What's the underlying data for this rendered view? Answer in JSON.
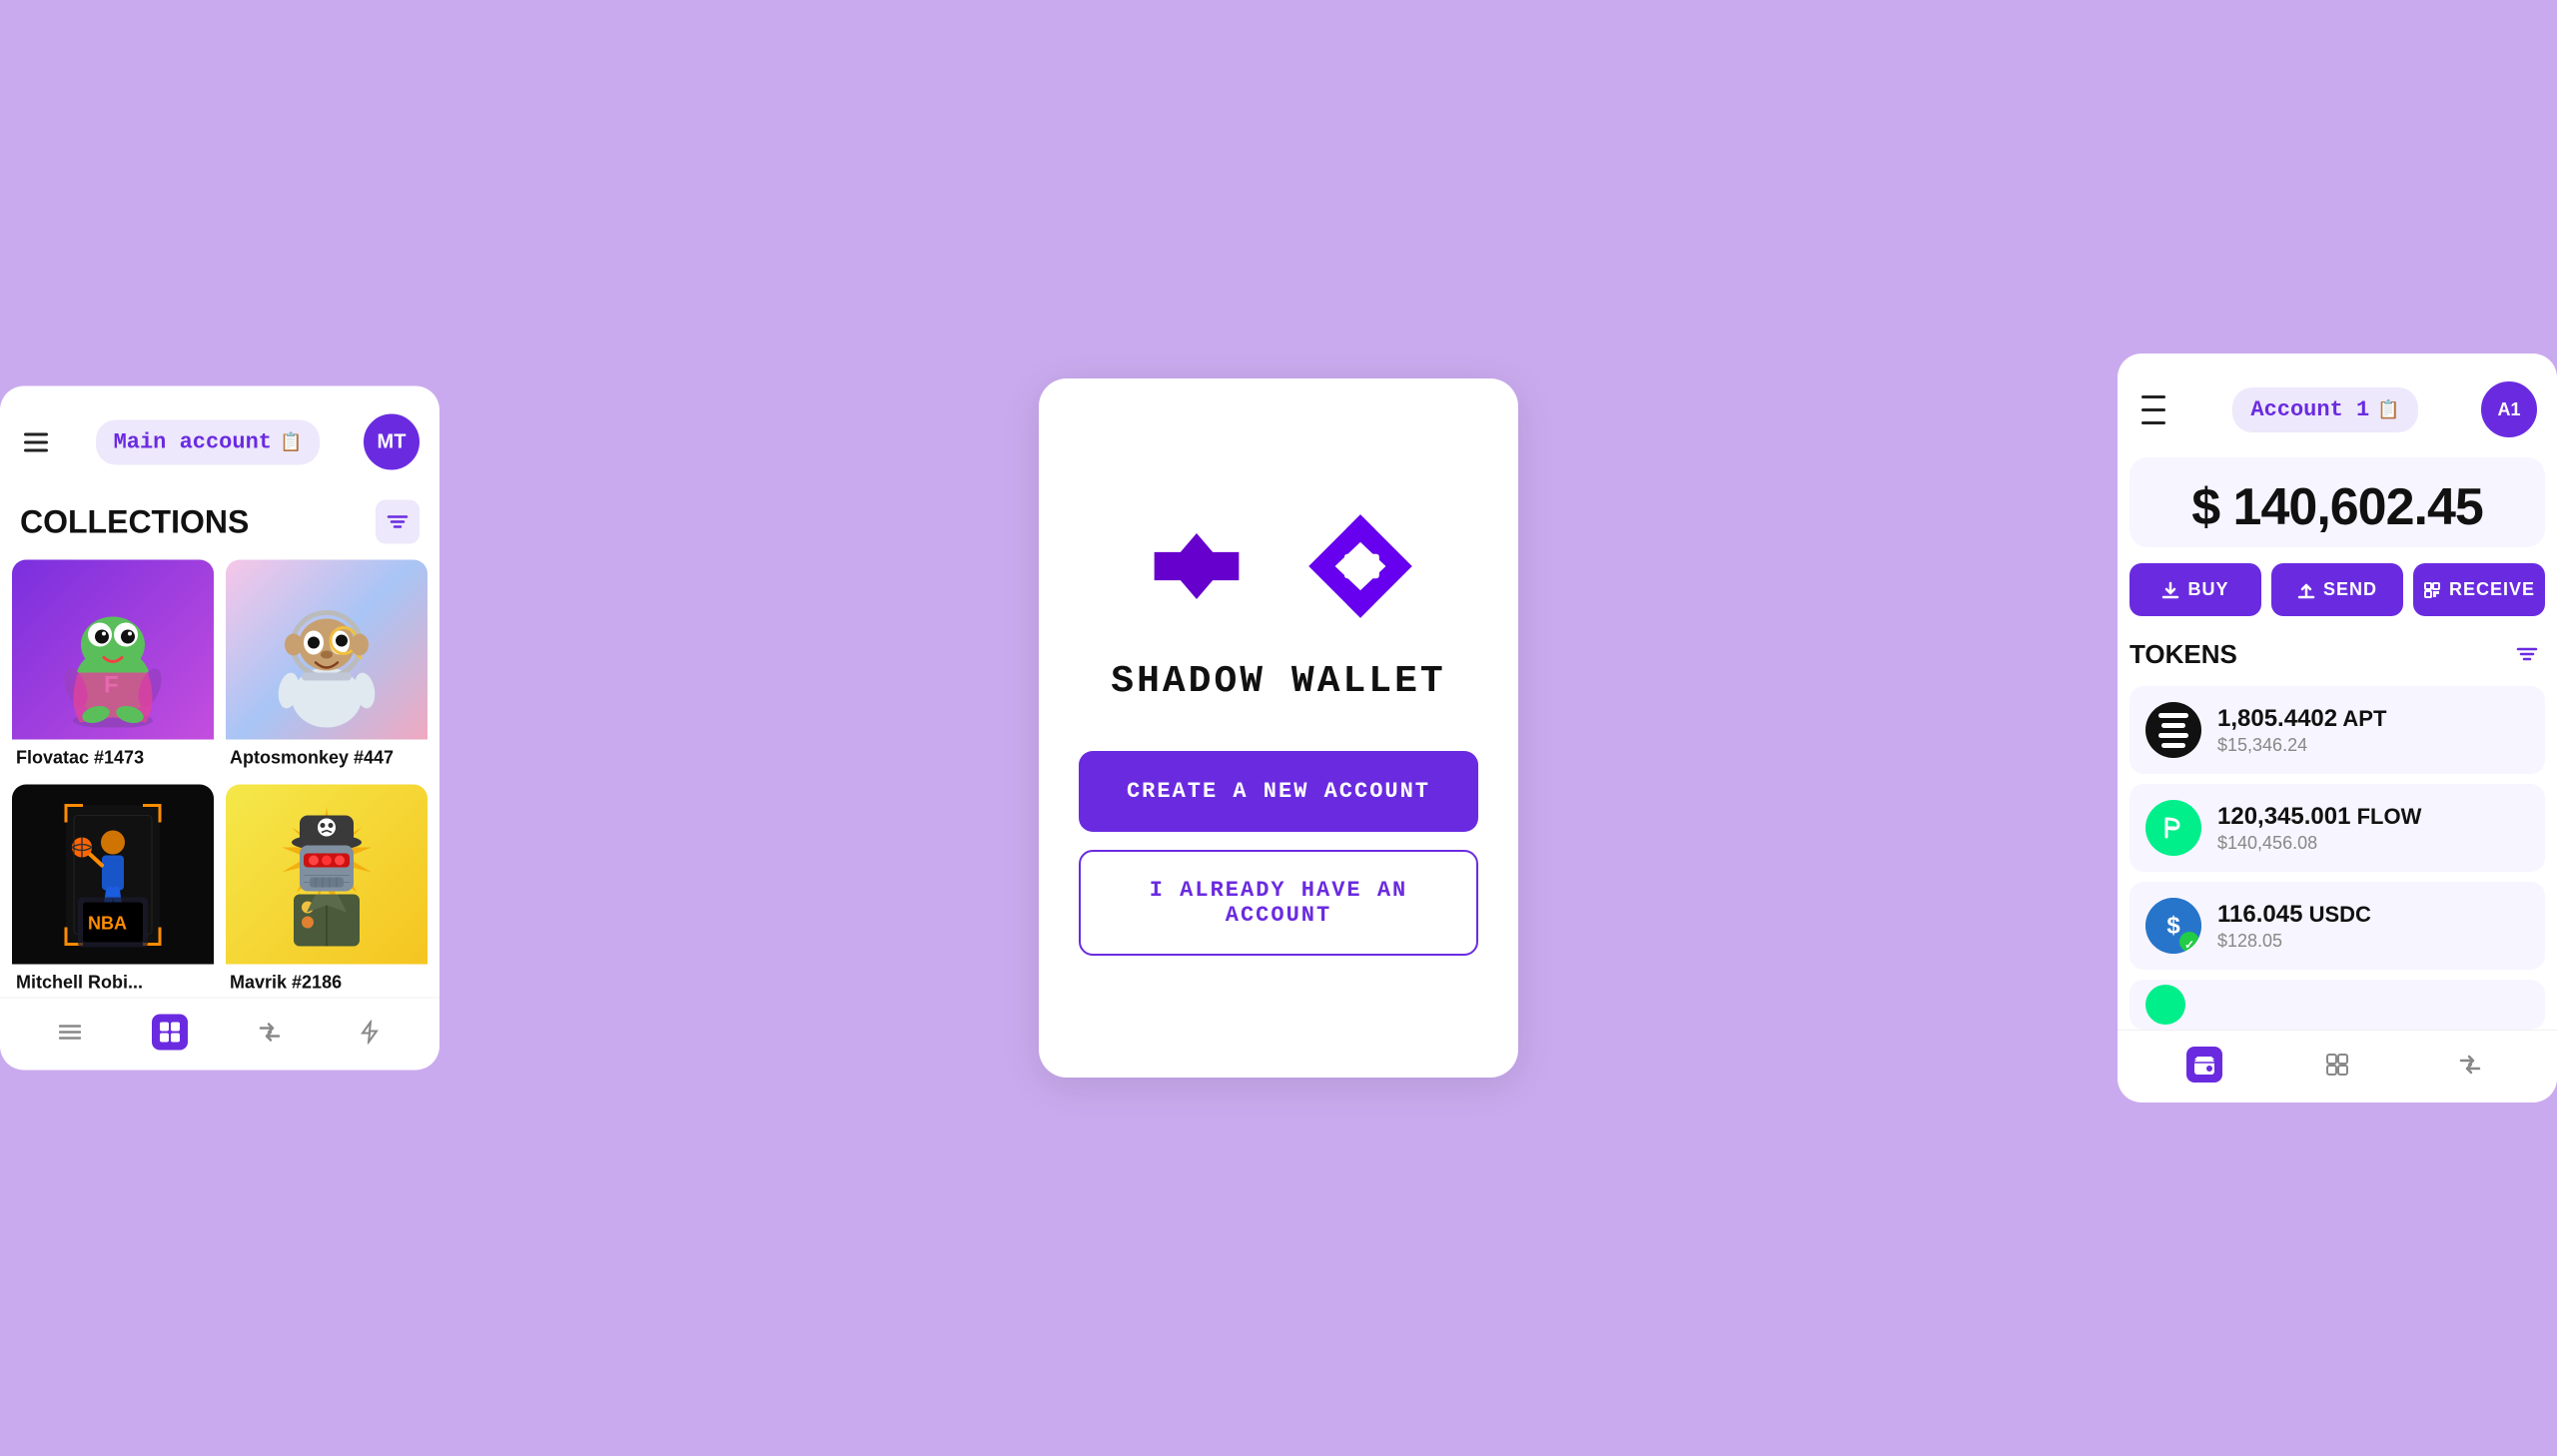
{
  "background": "#c9aaee",
  "left_panel": {
    "account_label": "Main account",
    "avatar_initials": "MT",
    "collections_title": "COLLECTIONS",
    "nfts": [
      {
        "name": "Flovatac #1473",
        "bg": "purple-bg"
      },
      {
        "name": "Aptosmonkey #447",
        "bg": "gradient-bg"
      },
      {
        "name": "Mitchell Robi...",
        "bg": "dark-bg"
      },
      {
        "name": "Mavrik #2186",
        "bg": "yellow-bg"
      }
    ],
    "nav_items": [
      "grid",
      "transfer",
      "lightning"
    ]
  },
  "center_panel": {
    "wallet_name": "SHADOW WALLET",
    "btn_create": "CREATE A NEW ACCOUNT",
    "btn_existing": "I ALREADY HAVE AN ACCOUNT"
  },
  "right_panel": {
    "account_label": "Account 1",
    "avatar_initials": "A1",
    "balance": "$ 140,602.45",
    "actions": [
      "BUY",
      "SEND",
      "RECEIVE"
    ],
    "tokens_title": "TOKENS",
    "tokens": [
      {
        "symbol": "APT",
        "amount": "1,805.4402",
        "usd": "$15,346.24",
        "type": "apt"
      },
      {
        "symbol": "FLOW",
        "amount": "120,345.001",
        "usd": "$140,456.08",
        "type": "flow"
      },
      {
        "symbol": "USDC",
        "amount": "116.045",
        "usd": "$128.05",
        "type": "usdc"
      }
    ]
  }
}
